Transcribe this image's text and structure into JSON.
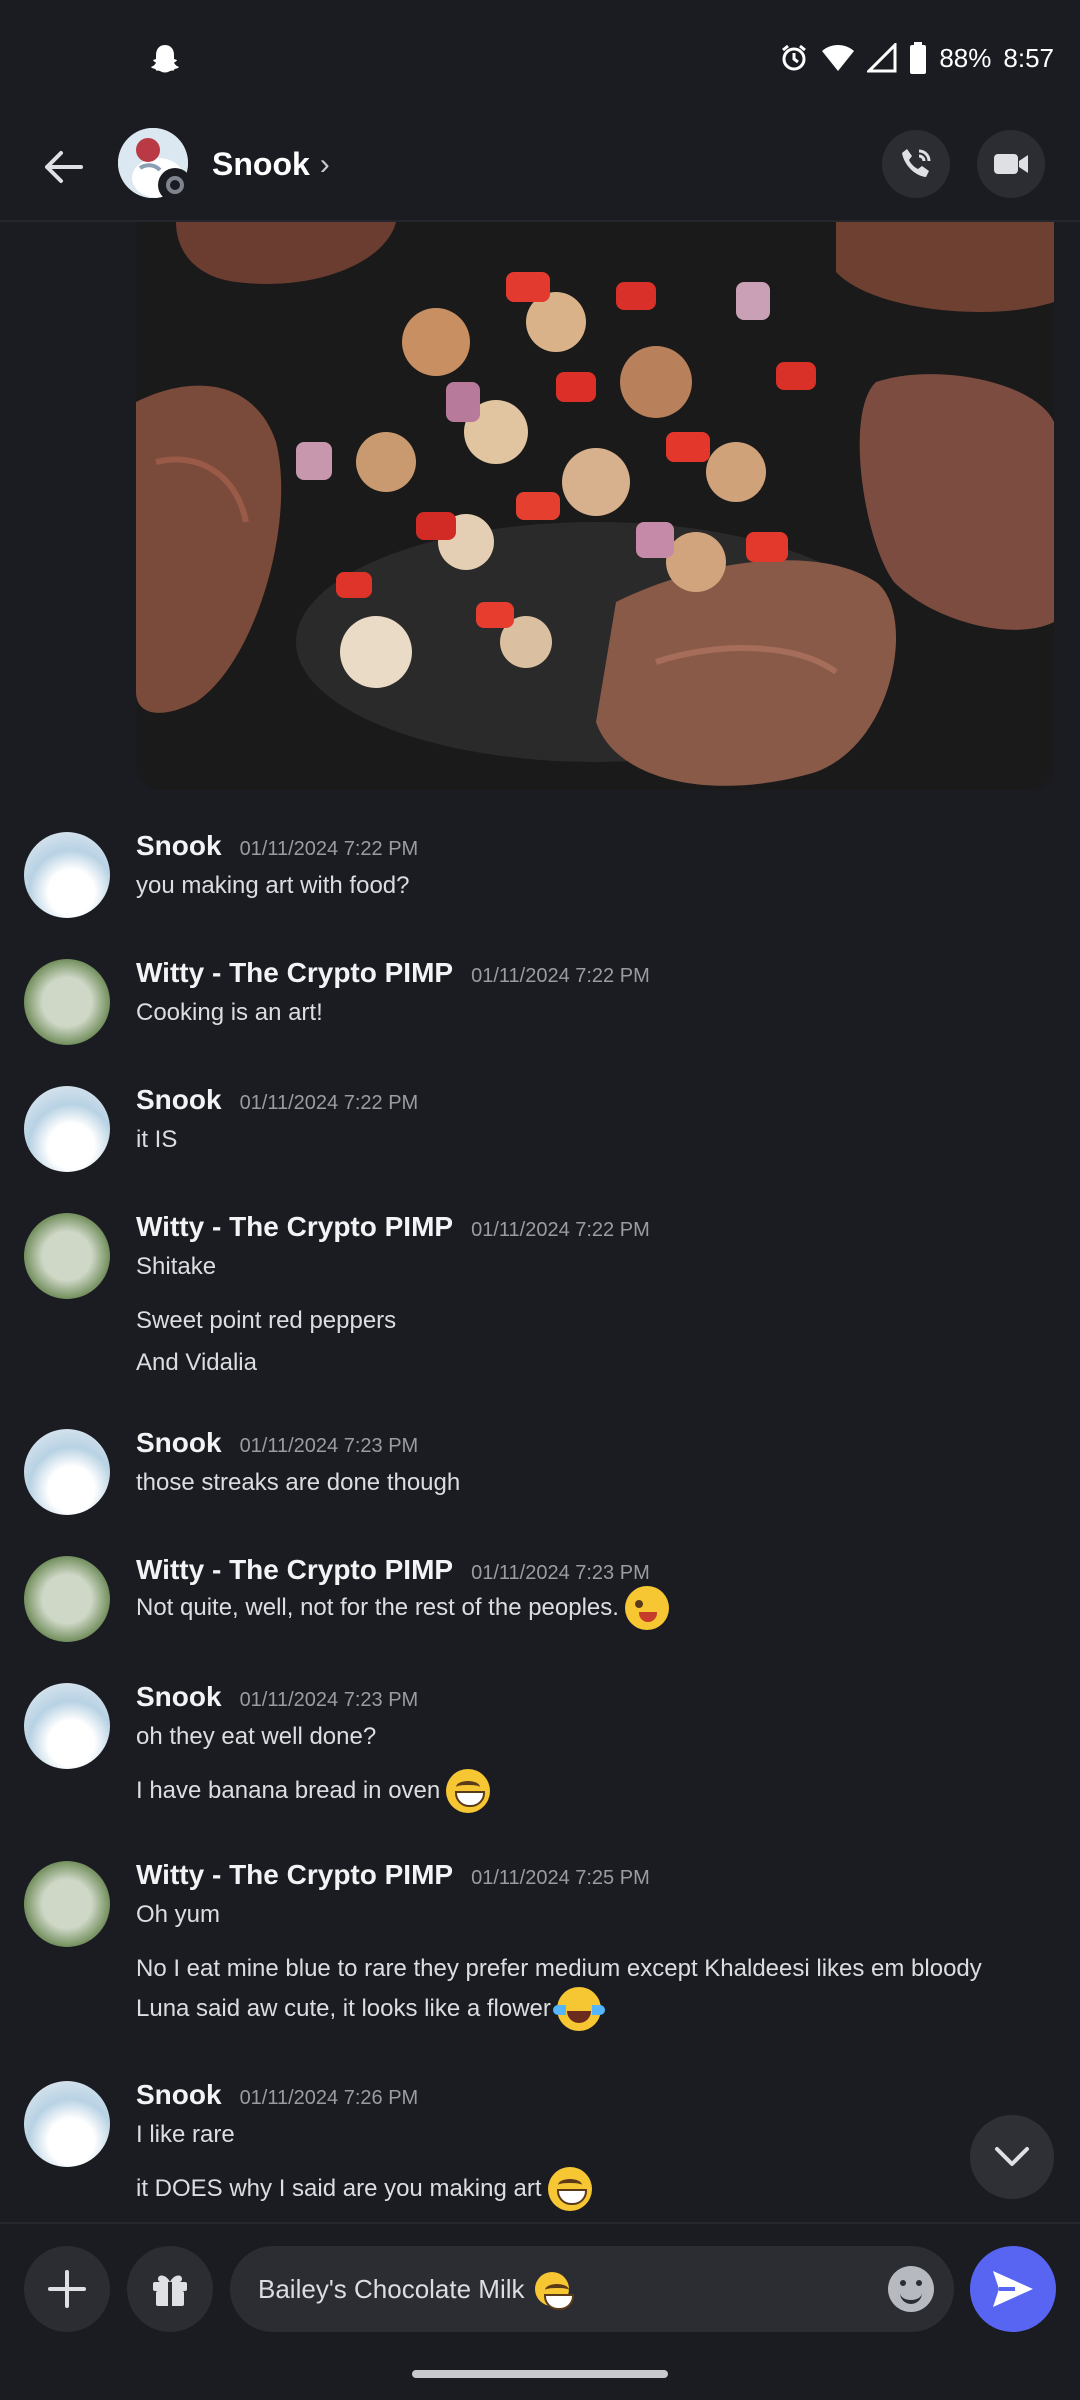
{
  "status_bar": {
    "battery": "88%",
    "time": "8:57",
    "left_icon": "snapchat-ghost-icon",
    "right_icons": [
      "alarm-icon",
      "wifi-icon",
      "signal-icon",
      "battery-icon"
    ]
  },
  "header": {
    "name": "Snook",
    "chevron": "›",
    "back_icon": "arrow-left-icon",
    "call_icon": "phone-call-icon",
    "video_icon": "video-camera-icon"
  },
  "messages": [
    {
      "user": "Snook",
      "time": "01/11/2024 7:22 PM",
      "lines": [
        {
          "text": "you making art with food?"
        }
      ]
    },
    {
      "user": "Witty - The Crypto PIMP",
      "time": "01/11/2024 7:22 PM",
      "lines": [
        {
          "text": "Cooking is an art!"
        }
      ]
    },
    {
      "user": "Snook",
      "time": "01/11/2024 7:22 PM",
      "lines": [
        {
          "text": "it IS"
        }
      ]
    },
    {
      "user": "Witty - The Crypto PIMP",
      "time": "01/11/2024 7:22 PM",
      "lines": [
        {
          "text": "Shitake"
        },
        {
          "text": "Sweet point red peppers"
        },
        {
          "text": "And Vidalia"
        }
      ]
    },
    {
      "user": "Snook",
      "time": "01/11/2024 7:23 PM",
      "lines": [
        {
          "text": "those streaks are done though"
        }
      ]
    },
    {
      "user": "Witty - The Crypto PIMP",
      "time": "01/11/2024 7:23 PM",
      "lines": [
        {
          "text": "Not quite, well, not for the rest of the peoples.",
          "emoji": "winking-face-tongue"
        }
      ]
    },
    {
      "user": "Snook",
      "time": "01/11/2024 7:23 PM",
      "lines": [
        {
          "text": "oh they eat well done?"
        },
        {
          "text": "I have banana bread in oven",
          "emoji": "grinning-face"
        }
      ]
    },
    {
      "user": "Witty - The Crypto PIMP",
      "time": "01/11/2024 7:25 PM",
      "lines": [
        {
          "text": "Oh yum"
        },
        {
          "text": "No I eat mine blue to rare they prefer medium except Khaldeesi likes em bloody"
        },
        {
          "text": "Luna said aw cute, it looks like a flower",
          "emoji": "face-with-tears-of-joy"
        }
      ]
    },
    {
      "user": "Snook",
      "time": "01/11/2024 7:26 PM",
      "lines": [
        {
          "text": "I like rare"
        },
        {
          "text": "it DOES why I said are you making art",
          "emoji": "grinning-face"
        }
      ]
    }
  ],
  "composer": {
    "value": "Bailey's Chocolate Milk",
    "value_emoji": "beaming-face",
    "plus_icon": "plus-icon",
    "gift_icon": "gift-icon",
    "emoji_icon": "emoji-picker-icon",
    "send_icon": "send-icon"
  },
  "scroll_down_icon": "chevron-down-icon",
  "colors": {
    "background": "#1b1c21",
    "surface": "#2b2d33",
    "accent": "#5865f2"
  }
}
